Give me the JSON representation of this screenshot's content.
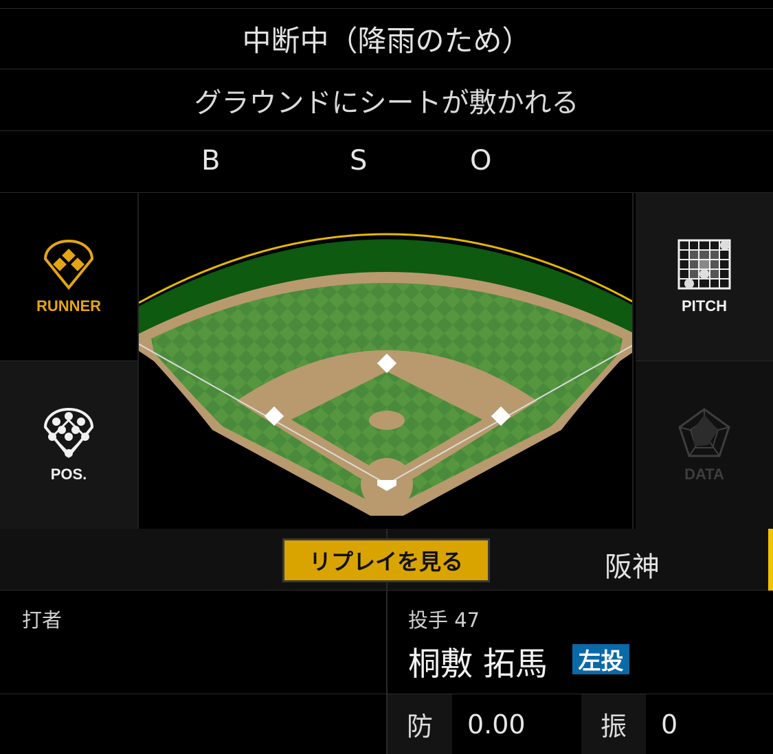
{
  "game_status": "中断中（降雨のため）",
  "event_text": "グラウンドにシートが敷かれる",
  "count": {
    "balls_label": "B",
    "strikes_label": "S",
    "outs_label": "O"
  },
  "side_buttons": {
    "runner": "RUNNER",
    "position": "POS.",
    "pitch": "PITCH",
    "data": "DATA"
  },
  "team_bar": {
    "replay_label": "リプレイを見る",
    "team_name": "阪神"
  },
  "batter": {
    "label": "打者"
  },
  "pitcher": {
    "label": "投手 47",
    "name": "桐敷 拓馬",
    "hand": "左投",
    "era_label": "防",
    "era_value": "0.00",
    "so_label": "振",
    "so_value": "0"
  },
  "colors": {
    "accent": "#d9a400",
    "badge": "#0a6aa8",
    "grass": "#4a8a3c",
    "dirt": "#b89a6e",
    "warning_track": "#0d5a10",
    "fence": "#e8b800"
  },
  "icons": {
    "runner": "diamond-bases-icon",
    "position": "fielder-positions-icon",
    "pitch": "strike-zone-grid-icon",
    "data": "radar-chart-icon"
  }
}
